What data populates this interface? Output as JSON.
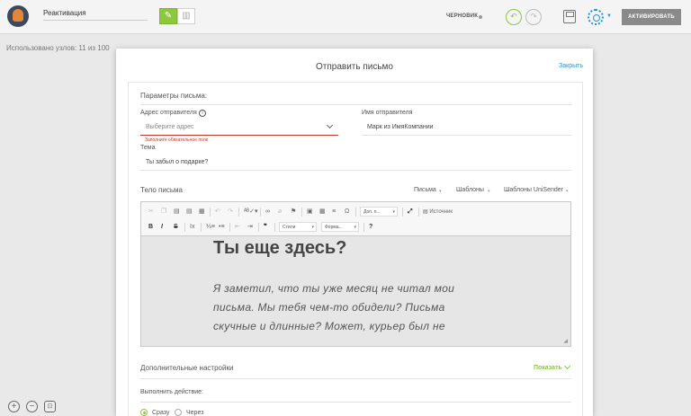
{
  "app": {
    "title": "Реактивация",
    "status": "ЧЕРНОВИК",
    "activate_label": "АКТИВИРОВАТЬ",
    "nodes_used": "Использовано узлов: 11 из 100",
    "accent_color": "#8dc63f",
    "link_color": "#1f96d8"
  },
  "modal": {
    "title": "Отправить письмо",
    "close_label": "Закрыть",
    "params_title": "Параметры письма:",
    "sender_address": {
      "label": "Адрес отправителя",
      "placeholder": "Выберите адрес",
      "error": "Заполните обязательное поле"
    },
    "sender_name": {
      "label": "Имя отправителя",
      "value": "Марк из ИмяКомпании"
    },
    "subject": {
      "label": "Тема",
      "value": "Ты забыл о подарке?"
    },
    "body": {
      "label": "Тело письма",
      "tabs": [
        "Письма",
        "Шаблоны",
        "Шаблоны UniSender"
      ]
    },
    "toolbar": {
      "extra_combo": "Доп. п...",
      "source_label": "Источник",
      "styles_combo": "Стили",
      "format_combo": "Форма...",
      "help": "?"
    },
    "content": {
      "heading": "Ты еще здесь?",
      "paragraph": "Я заметил, что ты уже месяц не читал мои письма. Мы тебя чем-то обидели? Письма скучные и длинные? Может, курьер был не"
    },
    "advanced": {
      "title": "Дополнительные настройки",
      "show_label": "Показать"
    },
    "action": {
      "label": "Выполнить действие:",
      "options": [
        "Сразу",
        "Через"
      ],
      "selected": "Сразу"
    }
  }
}
